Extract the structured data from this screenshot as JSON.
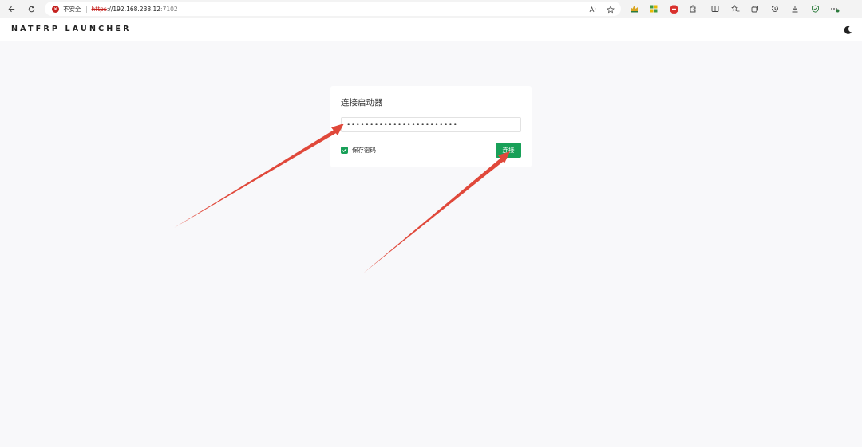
{
  "browser": {
    "security_label": "不安全",
    "url_scheme": "https",
    "url_host": "://192.168.238.12",
    "url_port": ":7102",
    "icons": [
      "back-icon",
      "reload-icon",
      "insecure-icon",
      "read-aloud-icon",
      "favorite-star-icon",
      "extension-icons",
      "split-screen-icon",
      "favorites-icon",
      "collections-icon",
      "history-icon",
      "downloads-icon",
      "browser-essentials-icon",
      "more-icon"
    ]
  },
  "app": {
    "title": "NATFRP LAUNCHER",
    "theme_toggle_icon": "moon-icon"
  },
  "login": {
    "title": "连接启动器",
    "password_value": "••••••••••••••••••••••••",
    "remember_label": "保存密码",
    "remember_checked": true,
    "connect_label": "连接"
  },
  "colors": {
    "accent": "#18a058",
    "background": "#f8f8fa",
    "arrow": "#e0483a",
    "insecure": "#c5221f"
  }
}
